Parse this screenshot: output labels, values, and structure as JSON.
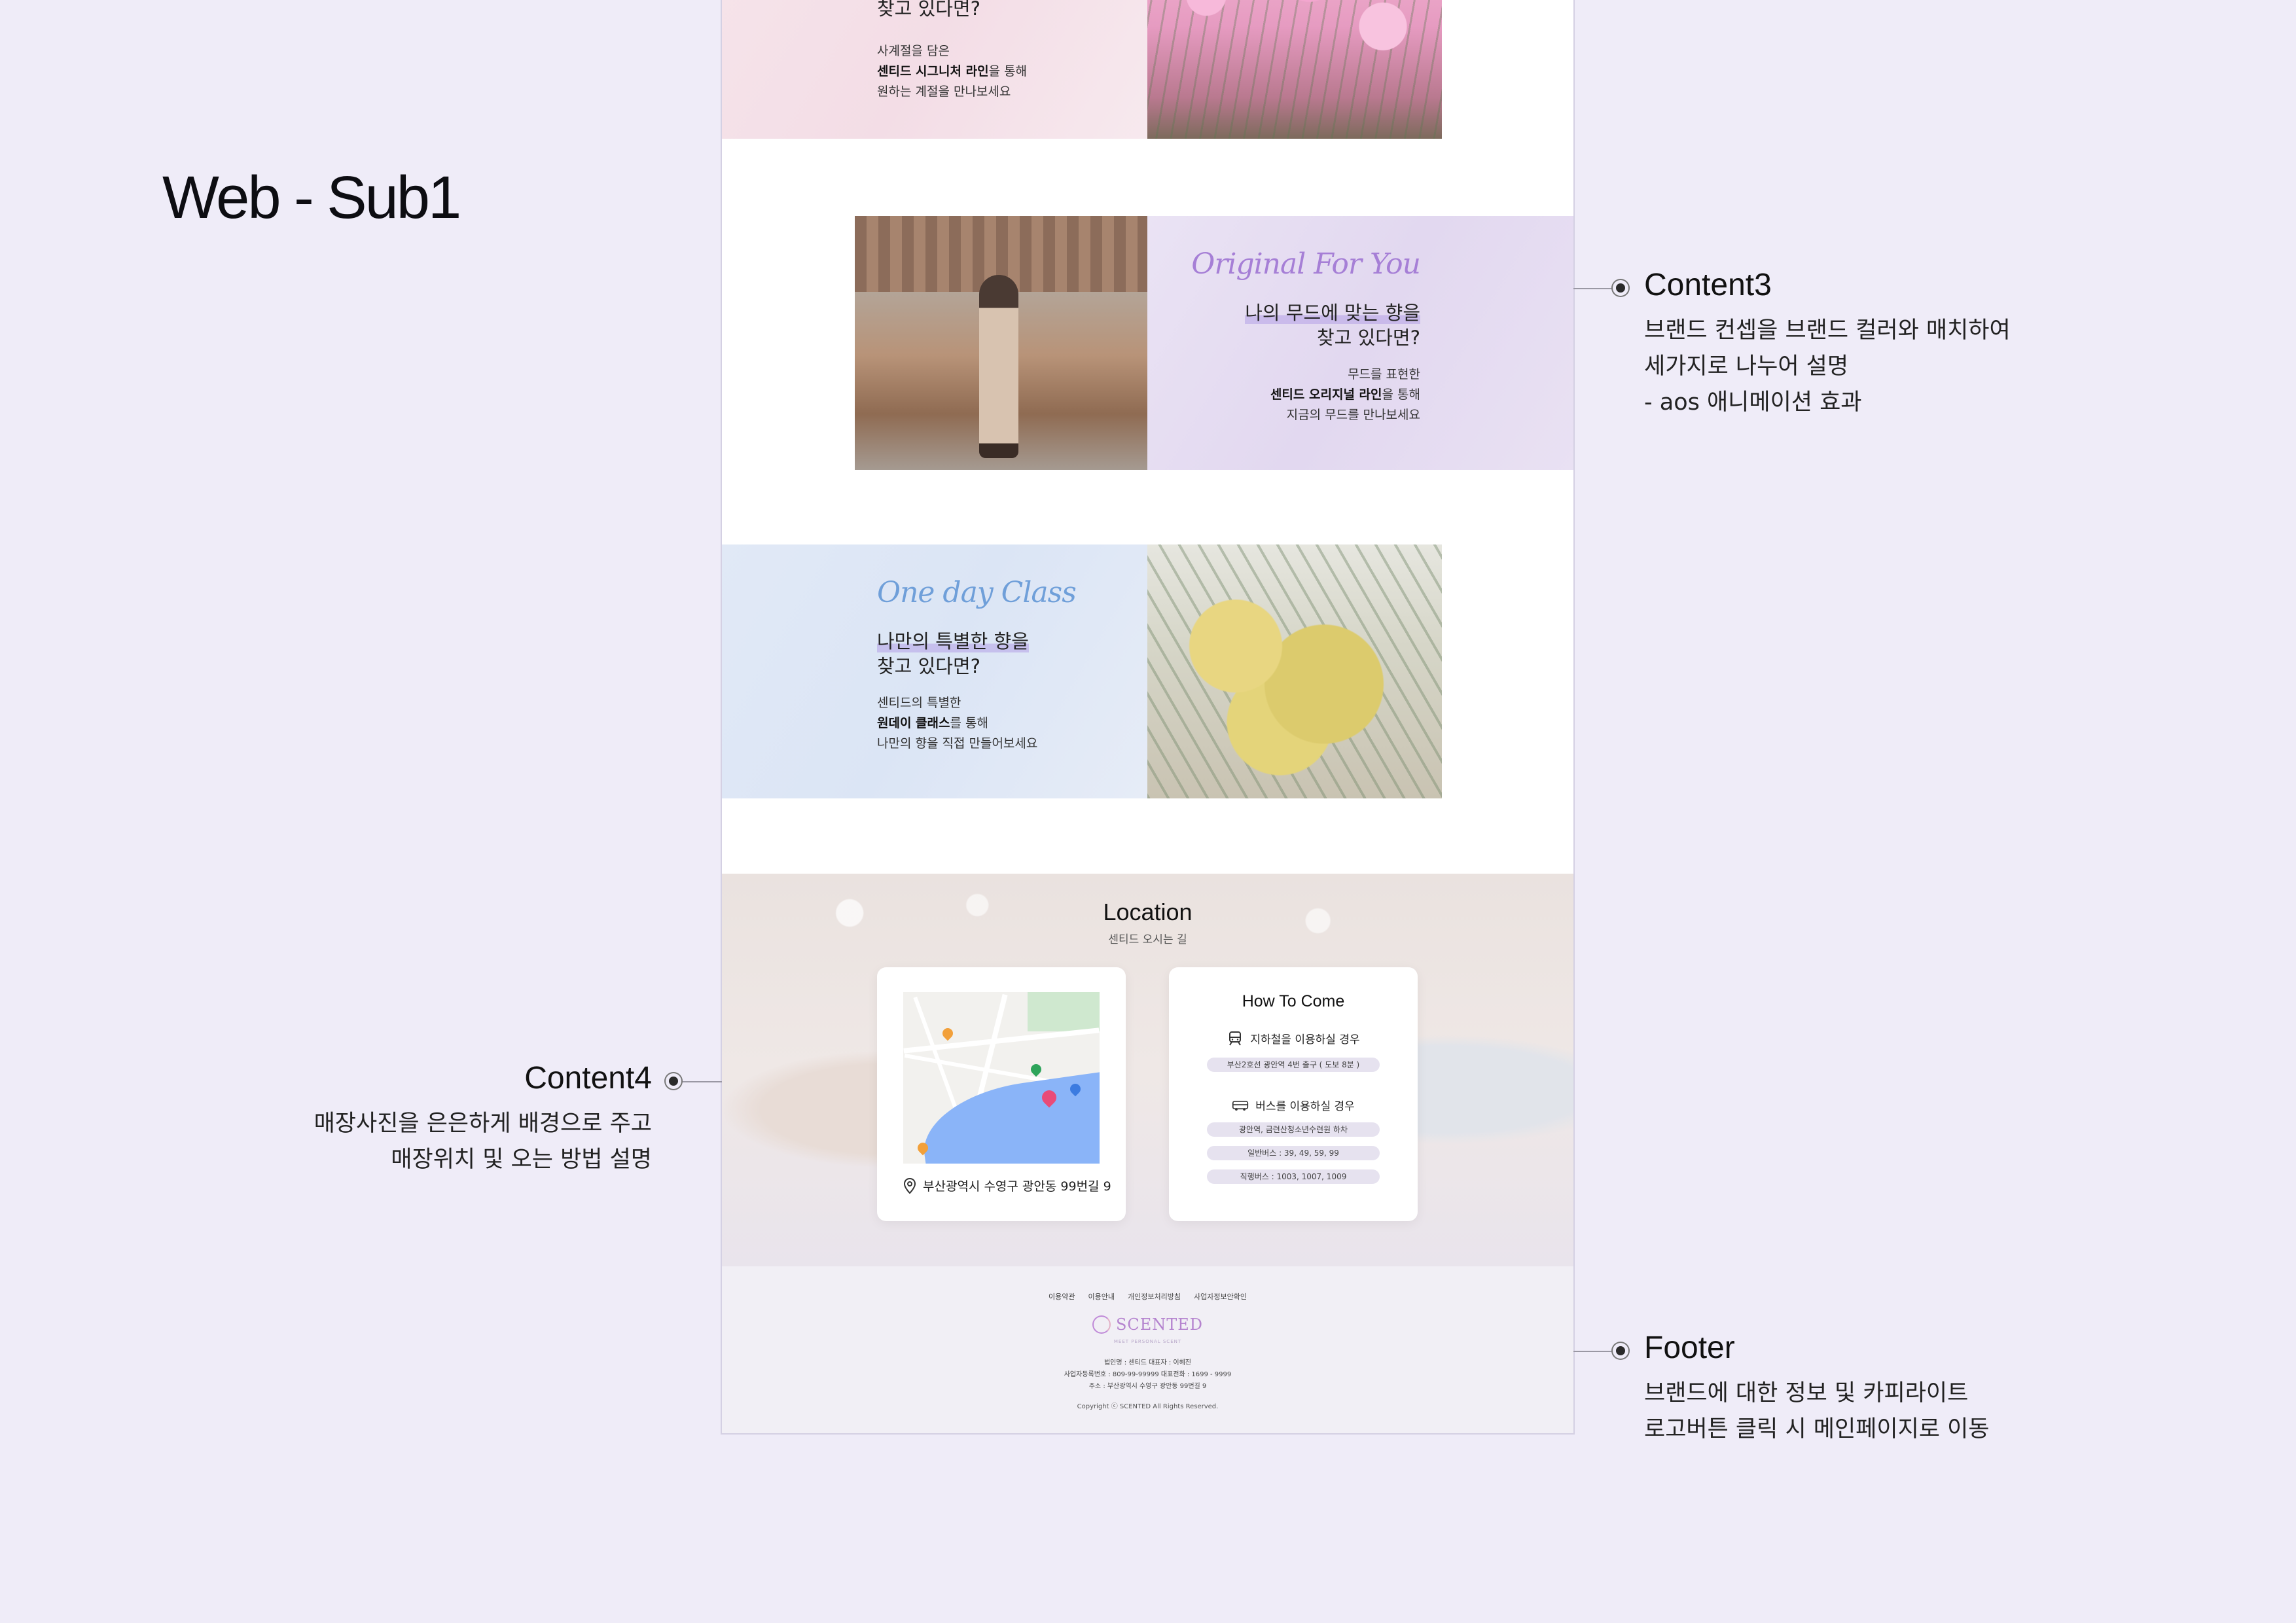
{
  "board": {
    "title": "Web - Sub1"
  },
  "annotations": {
    "content3": {
      "heading": "Content3",
      "lines": [
        "브랜드 컨셉을 브랜드 컬러와 매치하여",
        "세가지로 나누어 설명",
        "- aos 애니메이션 효과"
      ]
    },
    "content4": {
      "heading": "Content4",
      "lines": [
        "매장사진을 은은하게 배경으로 주고",
        "매장위치 및 오는 방법 설명"
      ]
    },
    "footer": {
      "heading": "Footer",
      "lines": [
        "브랜드에 대한 정보 및 카피라이트",
        "로고버튼 클릭 시 메인페이지로 이동"
      ]
    }
  },
  "cards": {
    "signature": {
      "question_line2": "찾고 있다면?",
      "desc_line1": "사계절을 담은",
      "desc_bold": "센티드 시그니처 라인",
      "desc_line2_rest": "을 통해",
      "desc_line3": "원하는 계절을 만나보세요"
    },
    "original": {
      "script_title": "Original For You",
      "question_line1": "나의 무드에 맞는 향을",
      "question_line2": "찾고 있다면?",
      "desc_line1": "무드를 표현한",
      "desc_bold": "센티드 오리지널 라인",
      "desc_line2_rest": "을 통해",
      "desc_line3": "지금의 무드를 만나보세요",
      "color": "#a67fd6"
    },
    "oneday": {
      "script_title": "One day Class",
      "question_line1": "나만의 특별한 향을",
      "question_line2": "찾고 있다면?",
      "desc_line1": "센티드의 특별한",
      "desc_bold": "원데이 클래스",
      "desc_line2_rest": "를 통해",
      "desc_line3": "나만의 향을 직접 만들어보세요",
      "color": "#6f9fd9"
    }
  },
  "location": {
    "title": "Location",
    "subtitle": "센티드 오시는 길",
    "address": "부산광역시 수영구 광안동 99번길 9",
    "how_to_come": {
      "title": "How To Come",
      "subway_heading": "지하철을 이용하실 경우",
      "subway_detail": "부산2호선 광안역 4번 출구 ( 도보 8분 )",
      "bus_heading": "버스를 이용하실 경우",
      "bus_stop": "광안역, 금련산청소년수련원 하차",
      "bus_general": "일반버스 : 39, 49, 59, 99",
      "bus_express": "직행버스 : 1003, 1007, 1009"
    }
  },
  "footer": {
    "links": [
      "이용약관",
      "이용안내",
      "개인정보처리방침",
      "사업자정보안확인"
    ],
    "logo_name": "SCENTED",
    "logo_tag": "MEET PERSONAL SCENT",
    "info_line1": "법인명 : 센티드     대표자 : 이혜진",
    "info_line2": "사업자등록번호 : 809-99-99999     대표전화 : 1699 - 9999",
    "info_line3": "주소 : 부산광역시 수영구 광안동 99번길 9",
    "copyright": "Copyright ⓒ SCENTED All Rights Reserved."
  }
}
